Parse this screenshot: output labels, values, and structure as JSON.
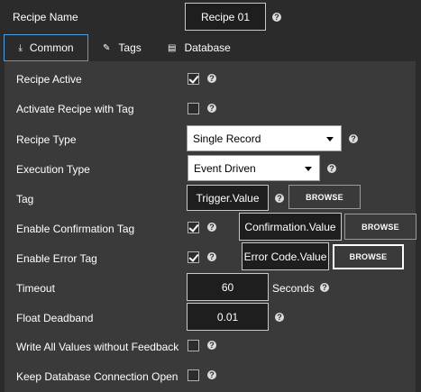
{
  "header": {
    "recipe_name_label": "Recipe Name",
    "recipe_name_value": "Recipe 01"
  },
  "tabs": [
    {
      "label": "Common",
      "icon": "download-icon",
      "active": true
    },
    {
      "label": "Tags",
      "icon": "tag-icon",
      "active": false
    },
    {
      "label": "Database",
      "icon": "database-icon",
      "active": false
    }
  ],
  "fields": {
    "recipe_active": {
      "label": "Recipe Active",
      "checked": true
    },
    "activate_with_tag": {
      "label": "Activate Recipe with Tag",
      "checked": false
    },
    "recipe_type": {
      "label": "Recipe Type",
      "value": "Single Record"
    },
    "execution_type": {
      "label": "Execution Type",
      "value": "Event Driven"
    },
    "tag": {
      "label": "Tag",
      "value": "Trigger.Value",
      "button": "BROWSE"
    },
    "confirmation_tag": {
      "label": "Enable Confirmation Tag",
      "checked": true,
      "value": "Confirmation.Value",
      "button": "BROWSE"
    },
    "error_tag": {
      "label": "Enable Error Tag",
      "checked": true,
      "value": "Error Code.Value",
      "button": "BROWSE"
    },
    "timeout": {
      "label": "Timeout",
      "value": "60",
      "unit": "Seconds"
    },
    "float_deadband": {
      "label": "Float Deadband",
      "value": "0.01"
    },
    "write_all": {
      "label": "Write All Values without Feedback",
      "checked": false
    },
    "keep_db_open": {
      "label": "Keep Database Connection Open",
      "checked": false
    }
  },
  "help_glyph": "?",
  "colors": {
    "background": "#2b2b2b",
    "panel": "#3a3a3a",
    "tab_accent": "#4a9fe0"
  }
}
